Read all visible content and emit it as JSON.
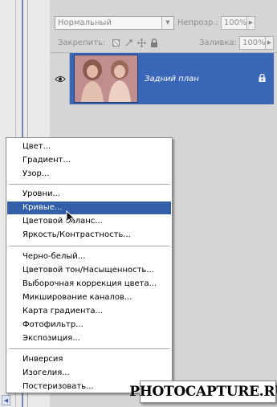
{
  "layers_panel": {
    "blend_mode": "Нормальный",
    "opacity_label": "Непрозр.:",
    "opacity_value": "100%",
    "lock_label": "Закрепить:",
    "fill_label": "Заливка:",
    "fill_value": "100%",
    "layer": {
      "name": "Задний план",
      "visibility_icon": "eye-icon",
      "lock_icon": "lock-icon"
    }
  },
  "adjustment_menu": {
    "groups": [
      [
        "Цвет...",
        "Градиент...",
        "Узор..."
      ],
      [
        "Уровни...",
        "Кривые...",
        "Цветовой баланс...",
        "Яркость/Контрастность..."
      ],
      [
        "Черно-белый...",
        "Цветовой тон/Насыщенность...",
        "Выборочная коррекция цвета...",
        "Микширование каналов...",
        "Карта градиента...",
        "Фотофильтр...",
        "Экспозиция..."
      ],
      [
        "Инверсия",
        "Изогелия...",
        "Постеризовать..."
      ]
    ],
    "highlighted": "Кривые..."
  },
  "watermark": "PHOTOCAPTURE.RU",
  "colors": {
    "accent": "#3a66b7",
    "menu_highlight": "#335ea8",
    "panel_bg": "#d5d5d5"
  }
}
